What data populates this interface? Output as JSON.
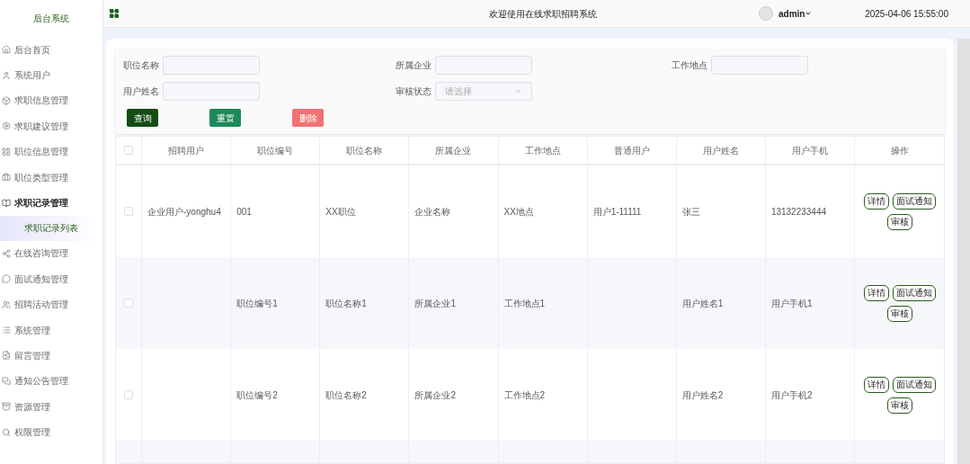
{
  "sidebar": {
    "title": "后台系统",
    "items": [
      {
        "label": "后台首页",
        "expanded": false
      },
      {
        "label": "系统用户",
        "expanded": false
      },
      {
        "label": "求职信息管理",
        "expanded": false
      },
      {
        "label": "求职建议管理",
        "expanded": false
      },
      {
        "label": "职位信息管理",
        "expanded": false
      },
      {
        "label": "职位类型管理",
        "expanded": false
      },
      {
        "label": "求职记录管理",
        "expanded": true,
        "children": [
          {
            "label": "求职记录列表",
            "selected": true
          }
        ]
      },
      {
        "label": "在线咨询管理",
        "expanded": false
      },
      {
        "label": "面试通知管理",
        "expanded": false
      },
      {
        "label": "招聘活动管理",
        "expanded": false
      },
      {
        "label": "系统管理",
        "expanded": false
      },
      {
        "label": "留言管理",
        "expanded": false
      },
      {
        "label": "通知公告管理",
        "expanded": false
      },
      {
        "label": "资源管理",
        "expanded": false
      },
      {
        "label": "权限管理",
        "expanded": false
      }
    ]
  },
  "header": {
    "title": "欢迎使用在线求职招聘系统",
    "user": "admin",
    "datetime": "2025-04-06 15:55:00"
  },
  "filters": [
    {
      "label": "职位名称",
      "kind": "text"
    },
    {
      "label": "所属企业",
      "kind": "text"
    },
    {
      "label": "工作地点",
      "kind": "text"
    },
    {
      "label": "用户姓名",
      "kind": "text"
    },
    {
      "label": "审核状态",
      "kind": "select",
      "placeholder": "请选择"
    }
  ],
  "actions": [
    {
      "label": "查询",
      "kind": "primary"
    },
    {
      "label": "重置",
      "kind": "success"
    },
    {
      "label": "删除",
      "kind": "danger"
    }
  ],
  "table": {
    "header_checked": false,
    "columns": [
      "招聘用户",
      "职位编号",
      "职位名称",
      "所属企业",
      "工作地点",
      "普通用户",
      "用户姓名",
      "用户手机",
      "操作"
    ],
    "rows": [
      {
        "checked": false,
        "cells": [
          "企业用户-yonghu4",
          "001",
          "XX职位",
          "企业名称",
          "XX地点",
          "用户1-11111",
          "张三",
          "13132233444"
        ],
        "buttons": [
          "详情",
          "面试通知",
          "审核"
        ]
      },
      {
        "checked": false,
        "cells": [
          "",
          "职位编号1",
          "职位名称1",
          "所属企业1",
          "工作地点1",
          "",
          "用户姓名1",
          "用户手机1"
        ],
        "buttons": [
          "详情",
          "面试通知",
          "审核"
        ]
      },
      {
        "checked": false,
        "cells": [
          "",
          "职位编号2",
          "职位名称2",
          "所属企业2",
          "工作地点2",
          "",
          "用户姓名2",
          "用户手机2"
        ],
        "buttons": [
          "详情",
          "面试通知",
          "审核"
        ]
      }
    ]
  }
}
